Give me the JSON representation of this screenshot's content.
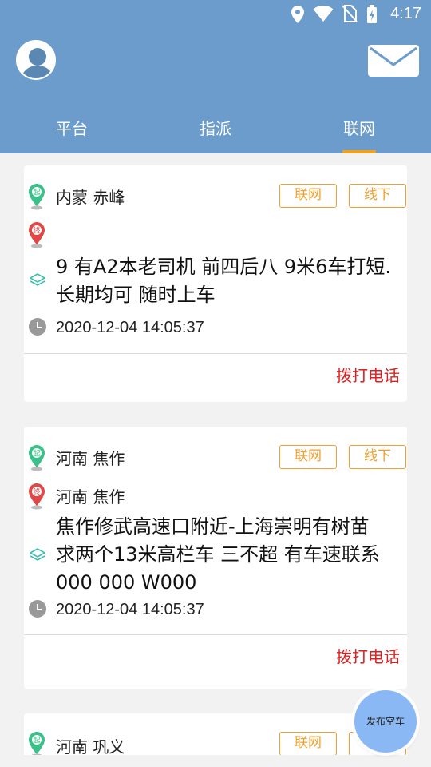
{
  "status_bar": {
    "time": "4:17"
  },
  "tabs": [
    {
      "label": "平台"
    },
    {
      "label": "指派"
    },
    {
      "label": "联网"
    }
  ],
  "cards": [
    {
      "origin": "内蒙 赤峰",
      "destination": "",
      "tag_primary": "联网",
      "tag_secondary": "线下",
      "content": " 9 有A2本老司机 前四后八 9米6车打短.长期均可 随时上车",
      "time": "2020-12-04 14:05:37",
      "call_label": "拨打电话"
    },
    {
      "origin": "河南 焦作",
      "destination": "河南 焦作",
      "tag_primary": "联网",
      "tag_secondary": "线下",
      "content": "焦作修武高速口附近-上海崇明有树苗 求两个13米高栏车 三不超 有车速联系 000 000 W000",
      "time": "2020-12-04 14:05:37",
      "call_label": "拨打电话"
    },
    {
      "origin": "河南 巩义",
      "tag_primary": "联网"
    }
  ],
  "icons": {
    "origin": "pin-start-icon",
    "destination": "pin-end-icon",
    "cargo": "layers-icon",
    "time": "clock-icon"
  },
  "fab": {
    "label": "发布空车"
  },
  "colors": {
    "header": "#6b9ccc",
    "accent": "#f0a030",
    "call": "#e02020",
    "origin_pin": "#3cc08a",
    "destination_pin": "#e04848",
    "fab": "#8ab8f4"
  }
}
